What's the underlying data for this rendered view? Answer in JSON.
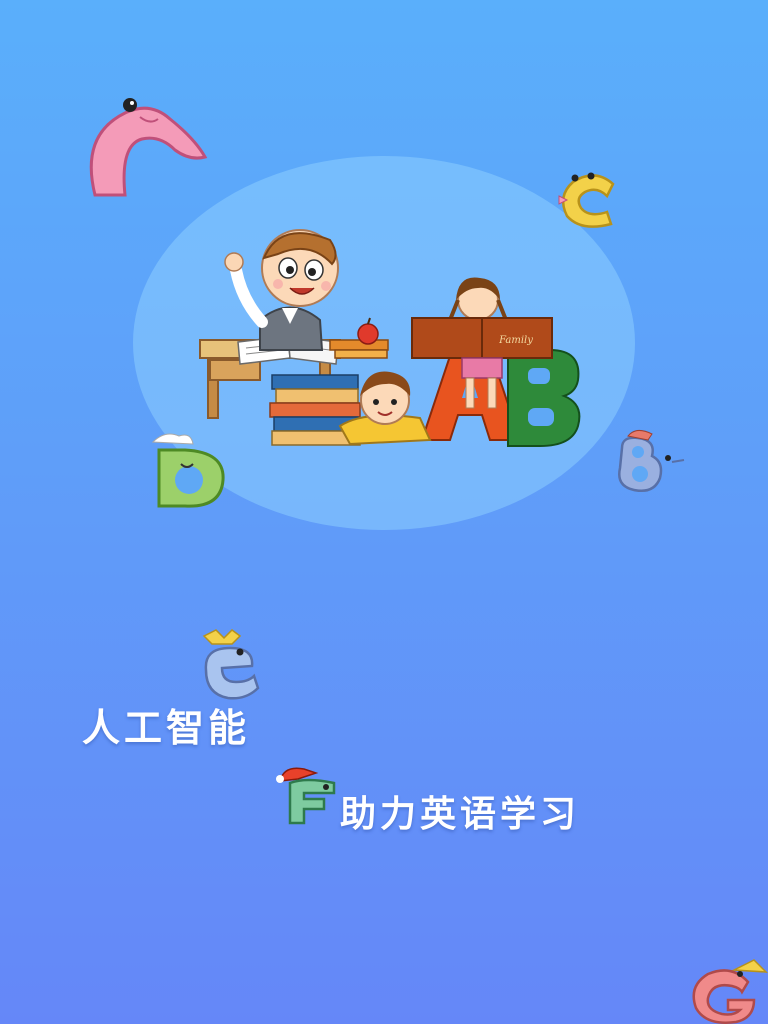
{
  "splash": {
    "slogan_line_1": "人工智能",
    "slogan_line_2": "助力英语学习"
  },
  "illustration": {
    "book_cover_text": "Family",
    "letter_a": "A",
    "letter_b": "B"
  },
  "mascots": {
    "a": "A",
    "c": "C",
    "d": "D",
    "b": "B",
    "e": "E",
    "f": "F",
    "g": "G"
  },
  "colors": {
    "background_top": "#5aaffb",
    "background_bottom": "#6587f8",
    "halo": "#8ccdff",
    "text": "#ffffff"
  }
}
